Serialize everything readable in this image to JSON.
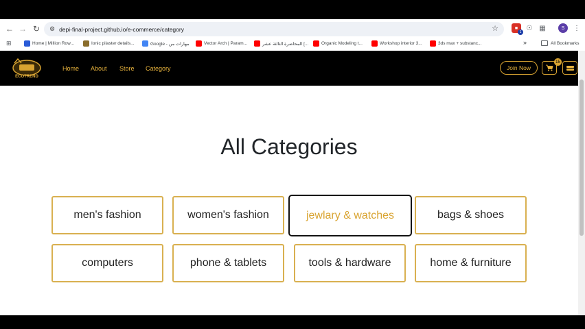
{
  "browser": {
    "url": "depi-final-project.github.io/e-commerce/category",
    "bookmarks": [
      {
        "label": "Home | Million Row...",
        "color": "#2a5bd7"
      },
      {
        "label": "Ionic pilaster details...",
        "color": "#8a6d2b"
      },
      {
        "label": "Google - مهارات من",
        "color": "#4285f4"
      },
      {
        "label": "Vector Arch | Param...",
        "color": "#ff0000"
      },
      {
        "label": "المحاضرة الثالثة عشر [...",
        "color": "#ff0000"
      },
      {
        "label": "Organic Modeling t...",
        "color": "#ff0000"
      },
      {
        "label": "Workshop interior 3...",
        "color": "#ff0000"
      },
      {
        "label": "3ds max + substanc...",
        "color": "#ff0000"
      }
    ],
    "more_bookmarks": "»",
    "all_bookmarks": "All Bookmarks",
    "profile_initial": "S",
    "extension_badge": "1"
  },
  "site": {
    "logo_text": "ECOTREND",
    "nav": [
      "Home",
      "About",
      "Store",
      "Category"
    ],
    "join_label": "Join Now",
    "cart_count": "15",
    "accent_color": "#d9a431"
  },
  "page": {
    "title": "All Categories",
    "categories": [
      "men's fashion",
      "women's fashion",
      "jewlary & watches",
      "bags & shoes",
      "computers",
      "phone & tablets",
      "tools & hardware",
      "home & furniture"
    ],
    "active_category": "jewlary & watches"
  }
}
